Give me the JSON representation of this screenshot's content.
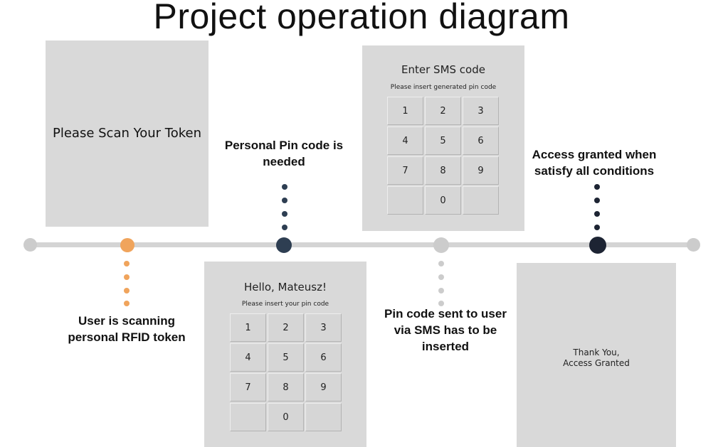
{
  "title": "Project operation diagram",
  "steps": [
    {
      "caption": "User is scanning personal RFID token",
      "caption_lines": [
        "User is scanning",
        "personal RFID token"
      ],
      "color": "#f0a45c",
      "screen": {
        "text": "Please Scan Your Token"
      }
    },
    {
      "caption": "Personal Pin code is needed",
      "caption_lines": [
        "Personal Pin code is",
        "needed"
      ],
      "color": "#2e3e52",
      "screen": {
        "heading": "Hello, Mateusz!",
        "subheading": "Please insert your pin code",
        "keys": [
          "1",
          "2",
          "3",
          "4",
          "5",
          "6",
          "7",
          "8",
          "9",
          "0"
        ]
      }
    },
    {
      "caption": "Pin code sent to user via SMS has to be inserted",
      "caption_lines": [
        "Pin code sent to user",
        "via SMS has to be",
        "inserted"
      ],
      "color": "#cccccc",
      "screen": {
        "heading": "Enter SMS code",
        "subheading": "Please insert generated pin code",
        "keys": [
          "1",
          "2",
          "3",
          "4",
          "5",
          "6",
          "7",
          "8",
          "9",
          "0"
        ]
      }
    },
    {
      "caption": "Access granted when satisfy all conditions",
      "caption_lines": [
        "Access granted when",
        "satisfy all conditions"
      ],
      "color": "#1d2433",
      "screen": {
        "text_lines": [
          "Thank You,",
          "Access Granted"
        ]
      }
    }
  ],
  "endpoint_color": "#cccccc",
  "timeline_color": "#d4d4d4"
}
